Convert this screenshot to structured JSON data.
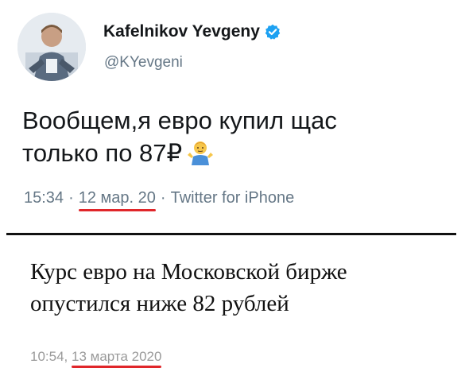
{
  "tweet": {
    "author_name": "Kafelnikov Yevgeny",
    "handle": "@KYevgeni",
    "verified_icon": "verified-badge-icon",
    "text_line1": "Вообщем,я евро купил щас",
    "text_line2": "только по 87₽",
    "emoji_icon": "man-shrugging-emoji",
    "time": "15:34",
    "separator": "·",
    "date": "12 мар. 20",
    "source": "Twitter for iPhone"
  },
  "news": {
    "headline_line1": "Курс евро на Московской бирже",
    "headline_line2": "опустился ниже 82 рублей",
    "time": "10:54,",
    "date": "13 марта 2020"
  },
  "colors": {
    "handle_gray": "#657786",
    "verified_blue": "#1da1f2",
    "underline_red": "#e0262a"
  }
}
